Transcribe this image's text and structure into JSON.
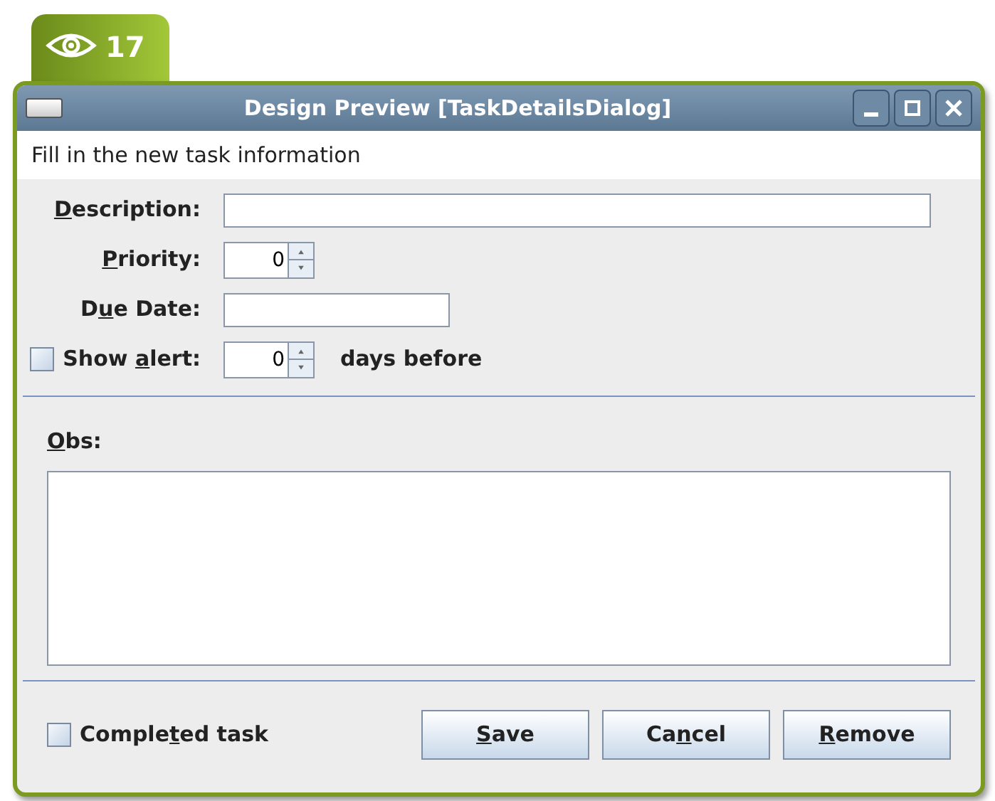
{
  "badge": {
    "count": "17"
  },
  "window": {
    "title": "Design Preview [TaskDetailsDialog]"
  },
  "header": {
    "text": "Fill in the new task information"
  },
  "fields": [
    {
      "kind": "text",
      "label": {
        "key": "D",
        "post": "escription:"
      }
    },
    {
      "kind": "spinner",
      "label": {
        "key": "P",
        "post": "riority:"
      },
      "value": "0"
    },
    {
      "kind": "date",
      "label": {
        "pre": "D",
        "key": "u",
        "post": "e Date:"
      }
    },
    {
      "kind": "alert",
      "label": {
        "pre": "Show ",
        "key": "a",
        "post": "lert:"
      },
      "checked": false,
      "value": "0",
      "suffix": "days before"
    }
  ],
  "obs": {
    "label": {
      "key": "O",
      "post": "bs:"
    }
  },
  "completed": {
    "label": {
      "pre": "Comple",
      "key": "t",
      "post": "ed task"
    },
    "checked": false
  },
  "buttons": [
    {
      "label": {
        "key": "S",
        "post": "ave"
      }
    },
    {
      "label": {
        "pre": "Ca",
        "key": "n",
        "post": "cel"
      }
    },
    {
      "label": {
        "key": "R",
        "post": "emove"
      }
    }
  ]
}
